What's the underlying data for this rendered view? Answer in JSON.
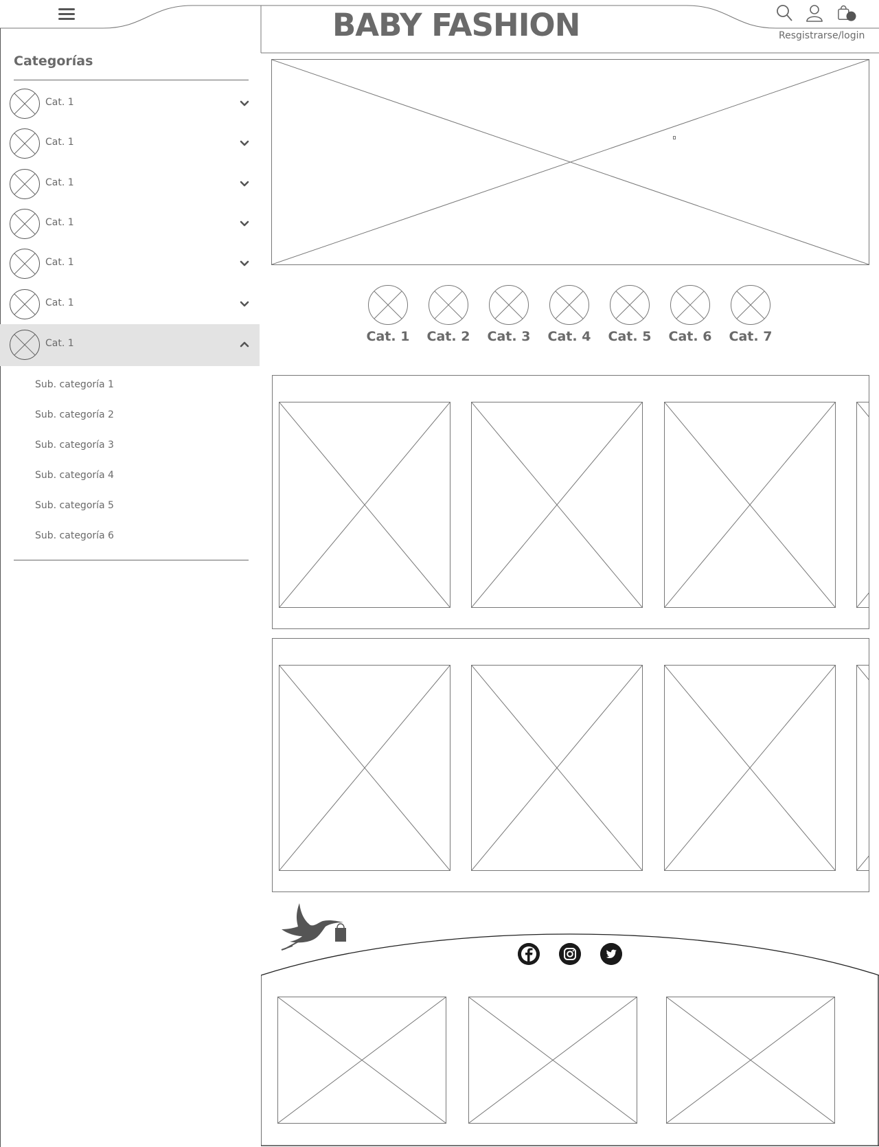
{
  "header": {
    "brand": "BABY FASHION",
    "login_label": "Resgistrarse/login",
    "icons": [
      "menu-icon",
      "search-icon",
      "user-icon",
      "cart-icon"
    ]
  },
  "sidebar": {
    "title": "Categorías",
    "categories": [
      {
        "label": "Cat. 1",
        "expanded": false
      },
      {
        "label": "Cat. 1",
        "expanded": false
      },
      {
        "label": "Cat. 1",
        "expanded": false
      },
      {
        "label": "Cat. 1",
        "expanded": false
      },
      {
        "label": "Cat. 1",
        "expanded": false
      },
      {
        "label": "Cat. 1",
        "expanded": false
      },
      {
        "label": "Cat. 1",
        "expanded": true
      }
    ],
    "subcategories": [
      "Sub. categoría 1",
      "Sub. categoría 2",
      "Sub. categoría 3",
      "Sub. categoría 4",
      "Sub. categoría 5",
      "Sub. categoría 6"
    ]
  },
  "main": {
    "category_row": [
      "Cat. 1",
      "Cat. 2",
      "Cat. 3",
      "Cat. 4",
      "Cat. 5",
      "Cat. 6",
      "Cat. 7"
    ]
  },
  "footer": {
    "social": [
      "facebook-icon",
      "instagram-icon",
      "twitter-icon"
    ]
  },
  "colors": {
    "text": "#6a6a6a",
    "line": "#777777",
    "active_bg": "#e3e3e3",
    "social_bg": "#1a1a1a"
  }
}
